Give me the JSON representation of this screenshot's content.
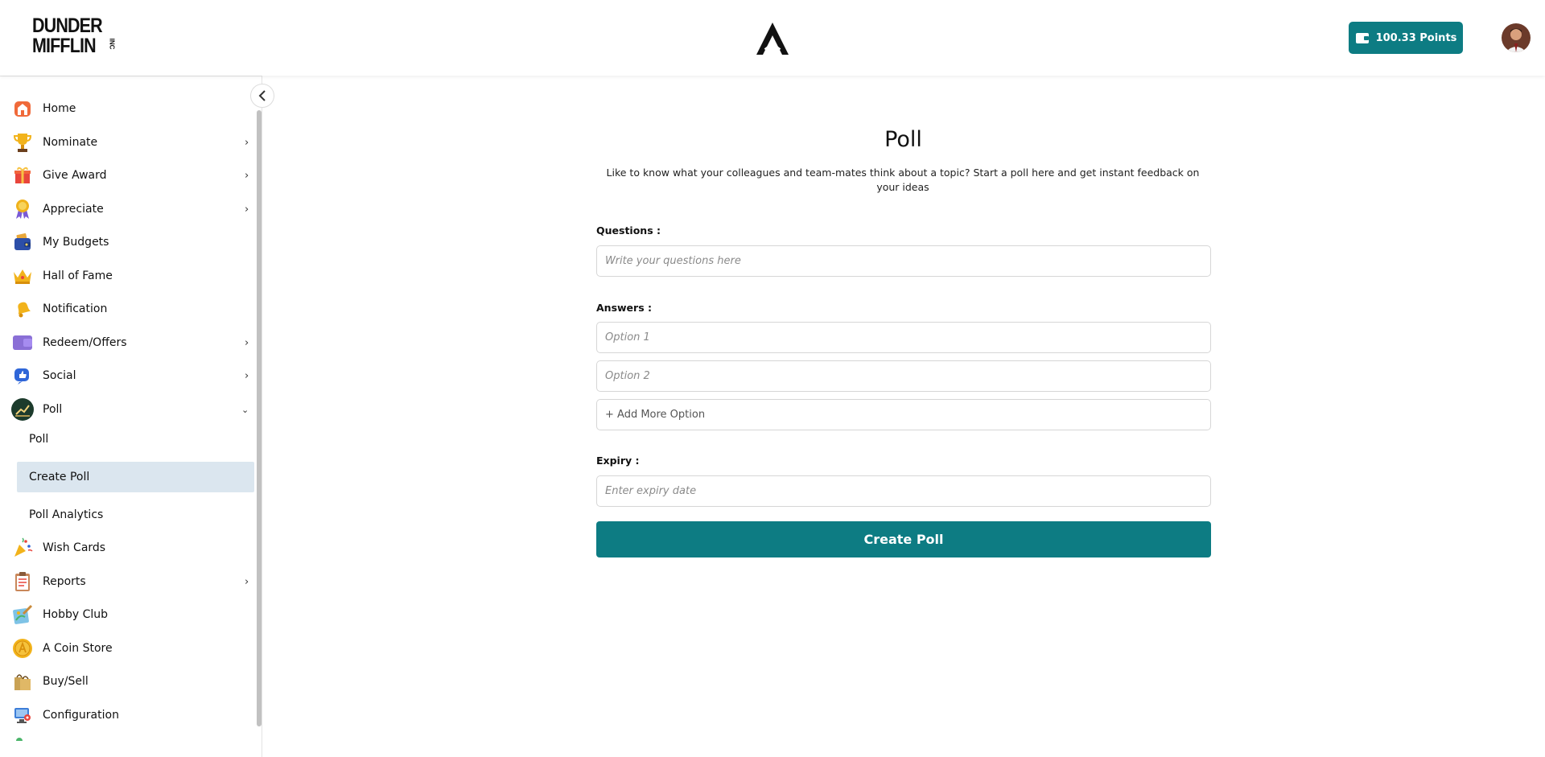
{
  "header": {
    "brand_line1": "DUNDER",
    "brand_line2": "MIFFLIN",
    "brand_inc": "INC",
    "points_label": "100.33  Points"
  },
  "sidebar": {
    "items": [
      {
        "label": "Home",
        "icon": "home-icon",
        "has_arrow": false
      },
      {
        "label": "Nominate",
        "icon": "trophy-icon",
        "has_arrow": true
      },
      {
        "label": "Give Award",
        "icon": "gift-icon",
        "has_arrow": true
      },
      {
        "label": "Appreciate",
        "icon": "ribbon-icon",
        "has_arrow": true
      },
      {
        "label": "My Budgets",
        "icon": "wallet-icon",
        "has_arrow": false
      },
      {
        "label": "Hall of Fame",
        "icon": "crown-icon",
        "has_arrow": false
      },
      {
        "label": "Notification",
        "icon": "bell-icon",
        "has_arrow": false
      },
      {
        "label": "Redeem/Offers",
        "icon": "offers-icon",
        "has_arrow": true
      },
      {
        "label": "Social",
        "icon": "thumbs-up-icon",
        "has_arrow": true
      },
      {
        "label": "Poll",
        "icon": "poll-icon",
        "has_arrow": true,
        "expanded": true
      },
      {
        "label": "Wish Cards",
        "icon": "party-popper-icon",
        "has_arrow": false
      },
      {
        "label": "Reports",
        "icon": "clipboard-icon",
        "has_arrow": true
      },
      {
        "label": "Hobby Club",
        "icon": "paint-icon",
        "has_arrow": false
      },
      {
        "label": "A Coin Store",
        "icon": "coin-icon",
        "has_arrow": false
      },
      {
        "label": "Buy/Sell",
        "icon": "shopping-bag-icon",
        "has_arrow": false
      },
      {
        "label": "Configuration",
        "icon": "monitor-settings-icon",
        "has_arrow": false
      }
    ],
    "poll_subitems": [
      {
        "label": "Poll",
        "active": false
      },
      {
        "label": "Create Poll",
        "active": true
      },
      {
        "label": "Poll Analytics",
        "active": false
      }
    ]
  },
  "main": {
    "title": "Poll",
    "subtitle": "Like to know what your colleagues and team-mates think about a topic? Start a poll here and get instant feedback on your ideas",
    "questions_label": "Questions :",
    "questions_placeholder": "Write your questions here",
    "answers_label": "Answers :",
    "option1_placeholder": "Option 1",
    "option2_placeholder": "Option 2",
    "add_option_label": "+ Add More Option",
    "expiry_label": "Expiry :",
    "expiry_placeholder": "Enter expiry date",
    "create_button": "Create Poll"
  },
  "colors": {
    "accent": "#0d7c83",
    "active_submenu_bg": "#dbe6ef"
  }
}
